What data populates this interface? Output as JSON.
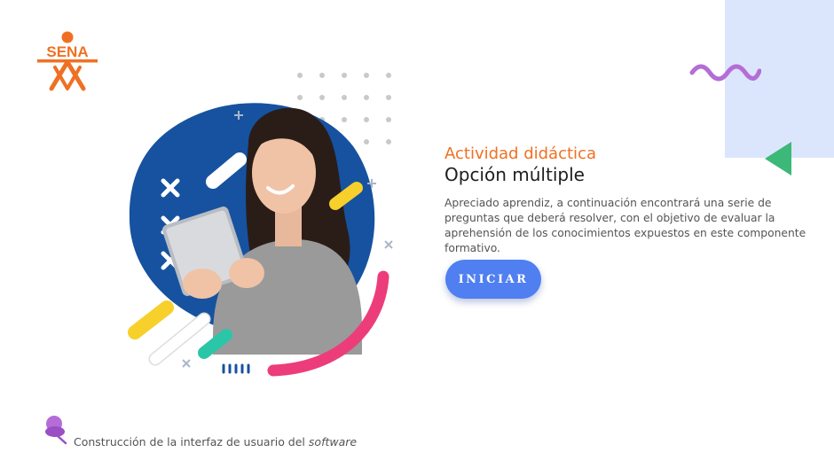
{
  "logo": {
    "text": "SENA",
    "color": "#ef7023"
  },
  "activity": {
    "subtitle": "Actividad didáctica",
    "title": "Opción múltiple",
    "description": "Apreciado aprendiz, a continuación encontrará una serie de preguntas que deberá resolver, con el objetivo de evaluar la aprehensión de los conocimientos expuestos en este componente formativo."
  },
  "start_button": {
    "label": "INICIAR",
    "color": "#4f7ff0"
  },
  "footer": {
    "text": "Construcción de la interfaz de usuario del",
    "emphasis": "software"
  },
  "colors": {
    "accent_orange": "#ef7023",
    "blob_blue": "#1652a0",
    "wave_purple": "#b46dd6",
    "triangle_green": "#3cb878",
    "light_blue_panel": "#dbe6fd",
    "stroke_yellow": "#f7d02c",
    "stroke_pink": "#ec3d7a",
    "stroke_teal": "#2bc6a7"
  },
  "icons": [
    "sena-logo",
    "squiggle-decoration",
    "triangle-decoration",
    "pushpin-icon"
  ]
}
